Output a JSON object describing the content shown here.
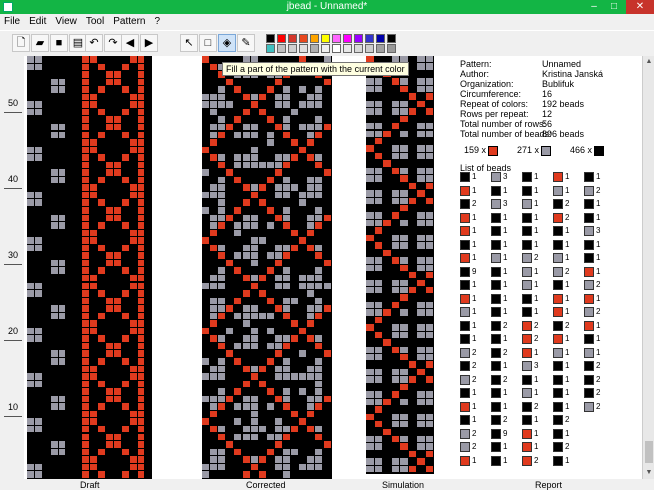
{
  "window": {
    "title": "jbead - Unnamed*",
    "minimize": "–",
    "maximize": "□",
    "close": "✕"
  },
  "menu": [
    "File",
    "Edit",
    "View",
    "Tool",
    "Pattern",
    "?"
  ],
  "toolbar": {
    "buttons": [
      "new-icon",
      "open-icon",
      "save-icon",
      "print-icon",
      "undo-icon",
      "redo-icon",
      "scroll-left-icon",
      "scroll-right-icon",
      "select-icon",
      "rectangle-icon",
      "fill-icon",
      "pencil-icon"
    ],
    "active_tool": "fill-icon",
    "palette_colors": [
      "#000000",
      "#ff0000",
      "#d4382c",
      "#e8491f",
      "#ffa500",
      "#ffff00",
      "#ff66ff",
      "#ff00ff",
      "#9900ff",
      "#3333cc",
      "#0000aa",
      "#000000",
      "#40c0c0",
      "#c0c0c0",
      "#d0d0d0",
      "#e0e0e0",
      "#b0b0b0",
      "#f0f0f0",
      "#ffffff",
      "#e8e8e8",
      "#d8d8d8",
      "#cccccc",
      "#a0a0a0",
      "#999999"
    ]
  },
  "tooltip": "Fill a part of the pattern with the current color",
  "ruler_labels": [
    "50",
    "40",
    "30",
    "20",
    "10"
  ],
  "view_labels": {
    "draft": "Draft",
    "corrected": "Corrected",
    "simulation": "Simulation",
    "report": "Report"
  },
  "report": {
    "fields": [
      {
        "label": "Pattern:",
        "value": "Unnamed"
      },
      {
        "label": "Author:",
        "value": "Kristina Janská"
      },
      {
        "label": "Organization:",
        "value": "Bublifuk"
      },
      {
        "label": "Circumference:",
        "value": "16"
      },
      {
        "label": "Repeat of colors:",
        "value": "192 beads"
      },
      {
        "label": "Rows per repeat:",
        "value": "12"
      },
      {
        "label": "Total number of rows:",
        "value": "56"
      },
      {
        "label": "Total number of beads:",
        "value": "896 beads"
      }
    ],
    "color_counts": [
      {
        "count": "159 x",
        "color": "#e03a1e"
      },
      {
        "count": "271 x",
        "color": "#9a9aa6"
      },
      {
        "count": "466 x",
        "color": "#000000"
      }
    ],
    "list_header": "List of beads",
    "bead_list": [
      [
        [
          "k",
          "1"
        ],
        [
          "r",
          "1"
        ],
        [
          "k",
          "2"
        ],
        [
          "r",
          "1"
        ],
        [
          "r",
          "1"
        ],
        [
          "k",
          "1"
        ],
        [
          "r",
          "1"
        ],
        [
          "k",
          "9"
        ],
        [
          "k",
          "1"
        ],
        [
          "r",
          "1"
        ],
        [
          "g",
          "1"
        ],
        [
          "k",
          "1"
        ],
        [
          "k",
          "1"
        ],
        [
          "g",
          "2"
        ],
        [
          "k",
          "2"
        ],
        [
          "g",
          "2"
        ],
        [
          "k",
          "1"
        ],
        [
          "r",
          "1"
        ],
        [
          "k",
          "1"
        ],
        [
          "g",
          "2"
        ],
        [
          "g",
          "2"
        ],
        [
          "r",
          "1"
        ]
      ],
      [
        [
          "g",
          "3"
        ],
        [
          "k",
          "1"
        ],
        [
          "g",
          "3"
        ],
        [
          "k",
          "1"
        ],
        [
          "k",
          "1"
        ],
        [
          "k",
          "1"
        ],
        [
          "g",
          "1"
        ],
        [
          "k",
          "1"
        ],
        [
          "k",
          "1"
        ],
        [
          "k",
          "1"
        ],
        [
          "k",
          "1"
        ],
        [
          "k",
          "2"
        ],
        [
          "k",
          "1"
        ],
        [
          "k",
          "2"
        ],
        [
          "k",
          "1"
        ],
        [
          "k",
          "2"
        ],
        [
          "k",
          "1"
        ],
        [
          "k",
          "1"
        ],
        [
          "k",
          "2"
        ],
        [
          "k",
          "9"
        ],
        [
          "k",
          "1"
        ],
        [
          "k",
          "1"
        ]
      ],
      [
        [
          "k",
          "1"
        ],
        [
          "k",
          "1"
        ],
        [
          "g",
          "1"
        ],
        [
          "k",
          "1"
        ],
        [
          "k",
          "1"
        ],
        [
          "k",
          "1"
        ],
        [
          "g",
          "2"
        ],
        [
          "g",
          "1"
        ],
        [
          "g",
          "1"
        ],
        [
          "k",
          "1"
        ],
        [
          "k",
          "1"
        ],
        [
          "r",
          "2"
        ],
        [
          "r",
          "2"
        ],
        [
          "r",
          "1"
        ],
        [
          "g",
          "3"
        ],
        [
          "k",
          "1"
        ],
        [
          "g",
          "1"
        ],
        [
          "k",
          "2"
        ],
        [
          "k",
          "1"
        ],
        [
          "r",
          "1"
        ],
        [
          "r",
          "1"
        ],
        [
          "r",
          "2"
        ]
      ],
      [
        [
          "r",
          "1"
        ],
        [
          "g",
          "1"
        ],
        [
          "k",
          "2"
        ],
        [
          "r",
          "2"
        ],
        [
          "k",
          "1"
        ],
        [
          "k",
          "1"
        ],
        [
          "g",
          "1"
        ],
        [
          "g",
          "2"
        ],
        [
          "k",
          "1"
        ],
        [
          "r",
          "1"
        ],
        [
          "r",
          "1"
        ],
        [
          "k",
          "2"
        ],
        [
          "r",
          "1"
        ],
        [
          "g",
          "1"
        ],
        [
          "k",
          "1"
        ],
        [
          "k",
          "1"
        ],
        [
          "k",
          "1"
        ],
        [
          "k",
          "1"
        ],
        [
          "k",
          "2"
        ],
        [
          "k",
          "1"
        ],
        [
          "k",
          "2"
        ],
        [
          "k",
          "1"
        ]
      ],
      [
        [
          "k",
          "1"
        ],
        [
          "g",
          "2"
        ],
        [
          "k",
          "1"
        ],
        [
          "k",
          "1"
        ],
        [
          "g",
          "3"
        ],
        [
          "k",
          "1"
        ],
        [
          "k",
          "1"
        ],
        [
          "r",
          "1"
        ],
        [
          "g",
          "2"
        ],
        [
          "r",
          "1"
        ],
        [
          "g",
          "2"
        ],
        [
          "r",
          "1"
        ],
        [
          "k",
          "1"
        ],
        [
          "g",
          "1"
        ],
        [
          "k",
          "2"
        ],
        [
          "k",
          "2"
        ],
        [
          "k",
          "2"
        ],
        [
          "g",
          "2"
        ]
      ]
    ]
  },
  "scrollbar": {
    "up": "▲",
    "down": "▼"
  }
}
